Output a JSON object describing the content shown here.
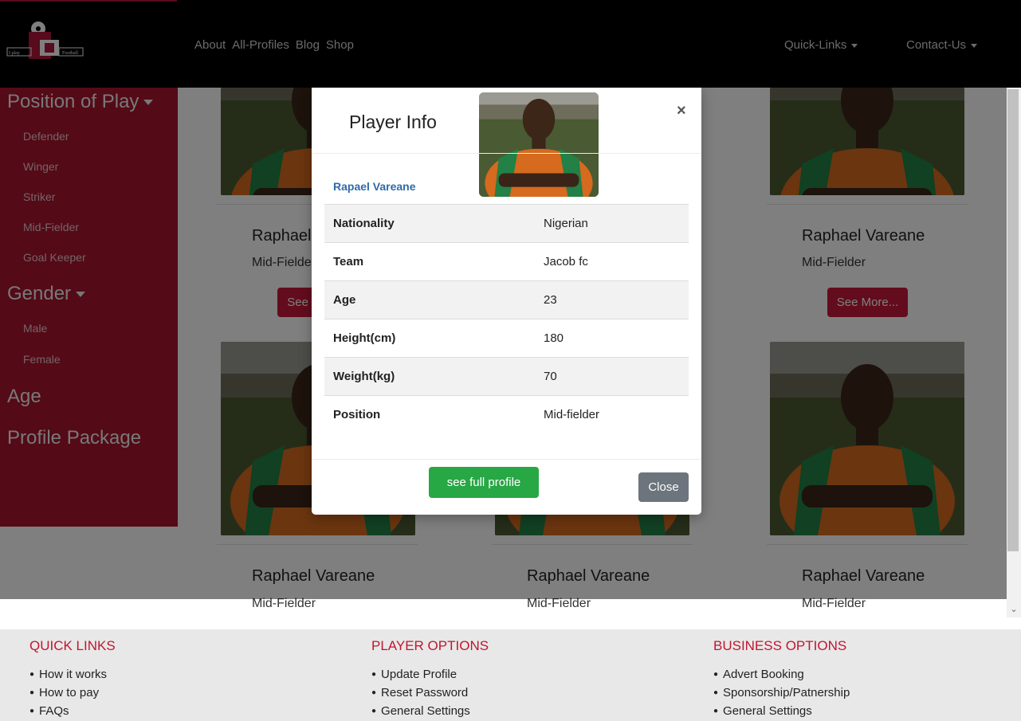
{
  "navbar": {
    "logo_text_left": "I play",
    "logo_text_right": "Football",
    "links": [
      "About",
      "All-Profiles",
      "Blog",
      "Shop"
    ],
    "quick_links": "Quick-Links",
    "contact_us": "Contact-Us"
  },
  "sidebar": {
    "position_heading": "Position of Play",
    "positions": [
      "Defender",
      "Winger",
      "Striker",
      "Mid-Fielder",
      "Goal Keeper"
    ],
    "gender_heading": "Gender",
    "genders": [
      "Male",
      "Female"
    ],
    "age_heading": "Age",
    "package_heading": "Profile Package"
  },
  "cards": [
    {
      "name": "Raphael Vareane",
      "position": "Mid-Fielder",
      "button": "See More..."
    },
    {
      "name": "Raphael Vareane",
      "position": "Mid-Fielder",
      "button": "See More..."
    },
    {
      "name": "Raphael Vareane",
      "position": "Mid-Fielder"
    },
    {
      "name": "Raphael Vareane",
      "position": "Mid-Fielder"
    },
    {
      "name": "Raphael Vareane",
      "position": "Mid-Fielder"
    }
  ],
  "modal": {
    "title": "Player Info",
    "close_x": "×",
    "player_name": "Rapael Vareane",
    "rows": [
      {
        "key": "Nationality",
        "value": "Nigerian"
      },
      {
        "key": "Team",
        "value": "Jacob fc"
      },
      {
        "key": "Age",
        "value": "23"
      },
      {
        "key": "Height(cm)",
        "value": "180"
      },
      {
        "key": "Weight(kg)",
        "value": "70"
      },
      {
        "key": "Position",
        "value": "Mid-fielder"
      }
    ],
    "full_profile_button": "see full profile",
    "close_button": "Close"
  },
  "footer": {
    "quick_links": {
      "heading": "QUICK LINKS",
      "items": [
        "How it works",
        "How to pay",
        "FAQs"
      ]
    },
    "player_options": {
      "heading": "PLAYER OPTIONS",
      "items": [
        "Update Profile",
        "Reset Password",
        "General Settings"
      ]
    },
    "business_options": {
      "heading": "BUSINESS OPTIONS",
      "items": [
        "Advert Booking",
        "Sponsorship/Patnership",
        "General Settings"
      ]
    }
  },
  "colors": {
    "brand": "#a8142f",
    "navbar": "#000000",
    "success": "#28a745",
    "secondary": "#6c757d",
    "link": "#2f6aa8"
  },
  "icons": [
    "scroll-down-chevron-icon",
    "close-icon",
    "caret-down-icon"
  ]
}
